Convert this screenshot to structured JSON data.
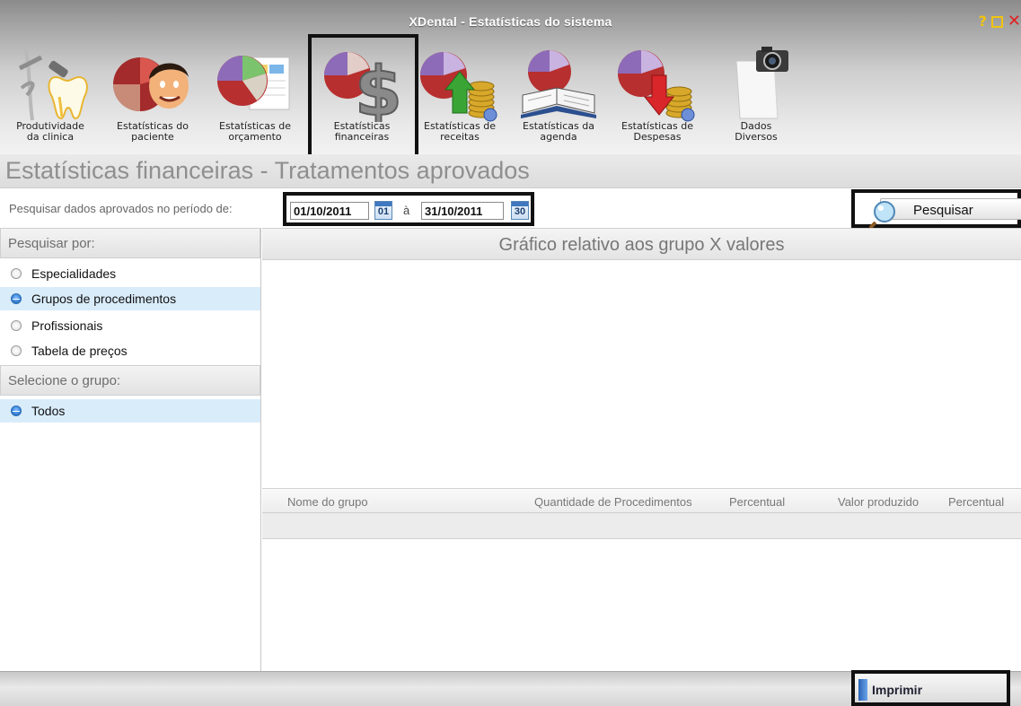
{
  "window": {
    "title": "XDental - Estatísticas do sistema",
    "controls": {
      "help_icon": "help-icon",
      "maximize_icon": "maximize-icon",
      "close_icon": "close-icon"
    }
  },
  "toolbar": {
    "items": [
      {
        "line1": "Produtividade",
        "line2": "da clinica",
        "icon": "dental-tools-icon"
      },
      {
        "line1": "Estatísticas do",
        "line2": "paciente",
        "icon": "pie-chart-patient-icon"
      },
      {
        "line1": "Estatísticas de",
        "line2": "orçamento",
        "icon": "pie-chart-report-icon"
      },
      {
        "line1": "Estatísticas",
        "line2": "financeiras",
        "icon": "pie-chart-dollar-icon",
        "selected": true
      },
      {
        "line1": "Estatísticas de",
        "line2": "receitas",
        "icon": "pie-chart-coins-up-icon"
      },
      {
        "line1": "Estatísticas da",
        "line2": "agenda",
        "icon": "pie-chart-book-icon"
      },
      {
        "line1": "Estatísticas de",
        "line2": "Despesas",
        "icon": "pie-chart-coins-down-icon"
      },
      {
        "line1": "Dados",
        "line2": "Diversos",
        "icon": "camera-document-icon"
      }
    ]
  },
  "page": {
    "heading": "Estatísticas financeiras - Tratamentos aprovados"
  },
  "search": {
    "period_label": "Pesquisar dados aprovados no período de:",
    "start_date": "01/10/2011",
    "start_cal_day": "01",
    "separator": "à",
    "end_date": "31/10/2011",
    "end_cal_day": "30",
    "button_label": "Pesquisar"
  },
  "left_panel": {
    "search_by_title": "Pesquisar por:",
    "search_by_options": [
      {
        "label": "Especialidades",
        "selected": false
      },
      {
        "label": "Grupos de procedimentos",
        "selected": true
      },
      {
        "label": "Profissionais",
        "selected": false
      },
      {
        "label": "Tabela de preços",
        "selected": false
      }
    ],
    "group_title": "Selecione o grupo:",
    "group_options": [
      {
        "label": "Todos",
        "selected": true
      }
    ]
  },
  "chart": {
    "title": "Gráfico relativo aos grupo X valores"
  },
  "grid": {
    "columns": [
      "Nome do grupo",
      "Quantidade de Procedimentos",
      "Percentual",
      "Valor produzido",
      "Percentual"
    ]
  },
  "footer": {
    "print_label": "Imprimir"
  },
  "colors": {
    "selected_row": "#d9ecfa",
    "radio_on": "#3a86db",
    "heading_text": "#8f8f8f",
    "close_red": "#e32020",
    "help_yellow": "#f1c40f"
  }
}
